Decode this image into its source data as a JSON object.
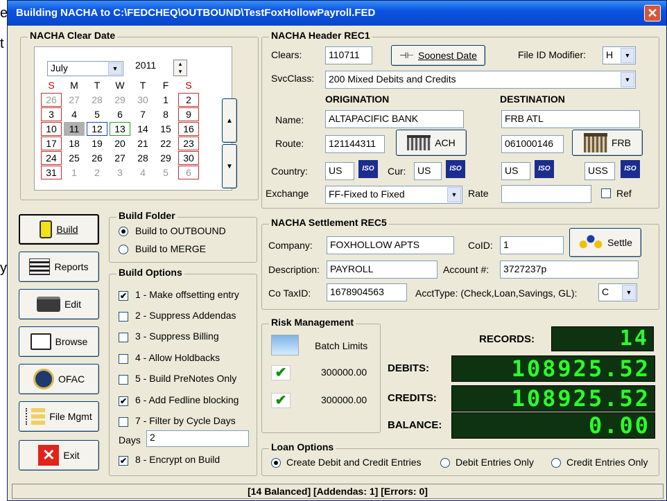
{
  "title": "Building NACHA to C:\\FEDCHEQ\\OUTBOUND\\TestFoxHollowPayroll.FED",
  "close_glyph": "✕",
  "bg_text": {
    "a": "e",
    "b": "t",
    "c": "y"
  },
  "clear_date": {
    "legend": "NACHA Clear Date",
    "month": "July",
    "year": "2011",
    "weekdays": [
      "S",
      "M",
      "T",
      "W",
      "T",
      "F",
      "S"
    ],
    "weeks": [
      [
        "26",
        "27",
        "28",
        "29",
        "30",
        "1",
        "2"
      ],
      [
        "3",
        "4",
        "5",
        "6",
        "7",
        "8",
        "9"
      ],
      [
        "10",
        "11",
        "12",
        "13",
        "14",
        "15",
        "16"
      ],
      [
        "17",
        "18",
        "19",
        "20",
        "21",
        "22",
        "23"
      ],
      [
        "24",
        "25",
        "26",
        "27",
        "28",
        "29",
        "30"
      ],
      [
        "31",
        "1",
        "2",
        "3",
        "4",
        "5",
        "6"
      ]
    ]
  },
  "header": {
    "legend": "NACHA Header REC1",
    "clears_label": "Clears:",
    "clears_value": "110711",
    "soonest_label": "Soonest Date",
    "file_id_label": "File ID Modifier:",
    "file_id_value": "H",
    "svcclass_label": "SvcClass:",
    "svcclass_value": "200 Mixed Debits and Credits",
    "origination": "ORIGINATION",
    "destination": "DESTINATION",
    "name_label": "Name:",
    "orig_name": "ALTAPACIFIC BANK",
    "dest_name": "FRB ATL",
    "route_label": "Route:",
    "orig_route": "121144311",
    "ach_label": "ACH",
    "dest_route": "061000146",
    "frb_label": "FRB",
    "country_label": "Country:",
    "orig_country": "US",
    "cur_label": "Cur:",
    "orig_cur": "US",
    "dest_country": "US",
    "dest_cur": "USS",
    "iso": "ISO",
    "exchange_label": "Exchange",
    "exchange_value": "FF-Fixed to Fixed",
    "rate_label": "Rate",
    "ref_label": "Ref"
  },
  "left_buttons": [
    "Build",
    "Reports",
    "Edit",
    "Browse",
    "OFAC",
    "File Mgmt",
    "Exit"
  ],
  "build_folder": {
    "legend": "Build Folder",
    "opt1": "Build to OUTBOUND",
    "opt2": "Build to MERGE"
  },
  "build_options": {
    "legend": "Build Options",
    "items": [
      {
        "label": "1 - Make offsetting entry",
        "checked": true
      },
      {
        "label": "2 - Suppress Addendas",
        "checked": false
      },
      {
        "label": "3 - Suppress Billing",
        "checked": false
      },
      {
        "label": "4 - Allow Holdbacks",
        "checked": false
      },
      {
        "label": "5 - Build PreNotes Only",
        "checked": false
      },
      {
        "label": "6 - Add Fedline blocking",
        "checked": true
      },
      {
        "label": "7 - Filter by Cycle Days",
        "checked": false
      },
      {
        "label": "8 - Encrypt on Build",
        "checked": true
      }
    ],
    "days_label": "Days",
    "days_value": "2",
    "check_glyph": "✔"
  },
  "settlement": {
    "legend": "NACHA Settlement REC5",
    "company_label": "Company:",
    "company_value": "FOXHOLLOW APTS",
    "coid_label": "CoID:",
    "coid_value": "1",
    "settle_label": "Settle",
    "desc_label": "Description:",
    "desc_value": "PAYROLL",
    "acct_label": "Account #:",
    "acct_value": "3727237p",
    "taxid_label": "Co TaxID:",
    "taxid_value": "1678904563",
    "accttype_label": "AcctType: (Check,Loan,Savings, GL):",
    "accttype_value": "C"
  },
  "risk": {
    "legend": "Risk Management",
    "batch_limits": "Batch Limits",
    "limit1": "300000.00",
    "limit2": "300000.00",
    "check_glyph": "✔"
  },
  "totals": {
    "records_label": "RECORDS:",
    "records_value": "14",
    "debits_label": "DEBITS:",
    "debits_value": "108925.52",
    "credits_label": "CREDITS:",
    "credits_value": "108925.52",
    "balance_label": "BALANCE:",
    "balance_value": "0.00"
  },
  "loan": {
    "legend": "Loan Options",
    "opt1": "Create Debit and Credit Entries",
    "opt2": "Debit Entries Only",
    "opt3": "Credit Entries Only"
  },
  "status": "[14 Balanced] [Addendas: 1] [Errors: 0]",
  "glyphs": {
    "down": "▼",
    "up": "▲",
    "spin_up": "▴",
    "spin_down": "▾"
  }
}
